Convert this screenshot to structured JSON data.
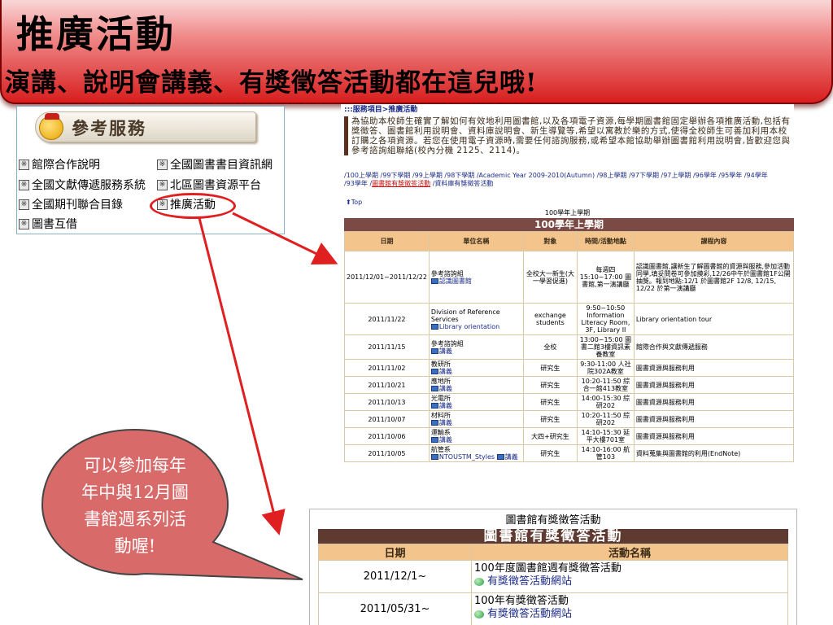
{
  "banner": {
    "title": "推廣活動",
    "subtitle": "演講、說明會講義、有獎徵答活動都在這兒哦!"
  },
  "services": {
    "title": "參考服務",
    "items": [
      "館際合作說明",
      "全國圖書書目資訊網",
      "全國文獻傳遞服務系統",
      "北區圖書資源平台",
      "全國期刊聯合目錄",
      "推廣活動",
      "圖書互借"
    ]
  },
  "bubble": {
    "lines": [
      "可以參加每年",
      "年中與12月圖",
      "書館週系列活",
      "動喔!"
    ]
  },
  "webpage": {
    "breadcrumb": ":::服務項目>推廣活動",
    "intro": "為協助本校師生確實了解如何有效地利用圖書館,以及各項電子資源,每學期圖書館固定舉辦各項推廣活動,包括有獎徵答、圖書館利用說明會、資料庫說明會、新生導覽等,希望以寓教於樂的方式,使得全校師生可善加利用本校訂購之各項資源。若您在使用電子資源時,需要任何諮詢服務,或希望本館協助舉辦圖書館利用說明會,皆歡迎您與參考諮詢組聯絡(校內分機 2125、2114)。",
    "semester_links": [
      "100上學期",
      "99下學期",
      "99上學期",
      "98下學期",
      "Academic Year 2009-2010(Autumn)",
      "98上學期",
      "97下學期",
      "97上學期",
      "96學年",
      "95學年",
      "94學年",
      "93學年",
      "圖書館有獎徵答活動",
      "資料庫有獎徵答活動"
    ],
    "active_link": "圖書館有獎徵答活動",
    "top_label": "Top",
    "table_caption": "100學年上學期",
    "table_band": "100學年上學期",
    "columns": [
      "日期",
      "單位名稱",
      "對象",
      "時間/活動地點",
      "課程內容"
    ],
    "rows": [
      {
        "date": "2011/12/01~2011/12/22",
        "unit": "參考諮詢組",
        "file": "認識圖書館",
        "target": "全校大一新生(大一學習促進)",
        "time": "每週四 15:10~17:00 圖書館,第一演講廳",
        "content": "認識圖書館,讓新生了解圖書館的資源與服務,參加活動同學,填妥問卷可參加摸彩,12/26中午於圖書館1F公開抽獎。報到地點:12/1 於圖書館2F 12/8, 12/15, 12/22 於第一演講廳"
      },
      {
        "date": "2011/11/22",
        "unit": "Division of Reference Services",
        "file": "Library orientation",
        "target": "exchange students",
        "time": "9:50~10:50 Information Literacy Room, 3F, Library II",
        "content": "Library orientation tour"
      },
      {
        "date": "2011/11/15",
        "unit": "參考諮詢組",
        "file": "講義",
        "target": "全校",
        "time": "13:00~15:00 圖書二館3樓資訊素養教室",
        "content": "館際合作與文獻傳遞服務"
      },
      {
        "date": "2011/11/02",
        "unit": "教研所",
        "file": "講義",
        "target": "研究生",
        "time": "9:30-11:00 人社院302A教室",
        "content": "圖書資源與服務利用"
      },
      {
        "date": "2011/10/21",
        "unit": "應地所",
        "file": "講義",
        "target": "研究生",
        "time": "10:20-11:50 綜合一館413教室",
        "content": "圖書資源與服務利用"
      },
      {
        "date": "2011/10/13",
        "unit": "光電所",
        "file": "講義",
        "target": "研究生",
        "time": "14:00-15:30 綜研202",
        "content": "圖書資源與服務利用"
      },
      {
        "date": "2011/10/07",
        "unit": "材料所",
        "file": "講義",
        "target": "研究生",
        "time": "10:20-11:50 綜研202",
        "content": "圖書資源與服務利用"
      },
      {
        "date": "2011/10/06",
        "unit": "運輸系",
        "file": "講義",
        "target": "大四+研究生",
        "time": "14:10-15:30 延平大樓701室",
        "content": "圖書資源與服務利用"
      },
      {
        "date": "2011/10/05",
        "unit": "航管系",
        "file": "NTOUSTM_Styles",
        "file2": "講義",
        "target": "研究生",
        "time": "14:10-16:00 航管103",
        "content": "資料蒐集與圖書館的利用(EndNote)"
      }
    ]
  },
  "activity": {
    "caption": "圖書館有獎徵答活動",
    "band": "圖書館有獎徵答活動",
    "columns": [
      "日期",
      "活動名稱"
    ],
    "rows": [
      {
        "date": "2011/12/1~",
        "name": "100年度圖書館週有獎徵答活動",
        "link": "有獎徵答活動網站"
      },
      {
        "date": "2011/05/31~",
        "name": "100年有獎徵答活動",
        "link": "有獎徵答活動網站"
      }
    ]
  },
  "colors": {
    "banner_red": "#d81e1e",
    "band_brown": "#7b4a44",
    "header_tan": "#f3c58c",
    "highlight_red": "#e02020",
    "bubble_fill": "#d86a6a"
  }
}
